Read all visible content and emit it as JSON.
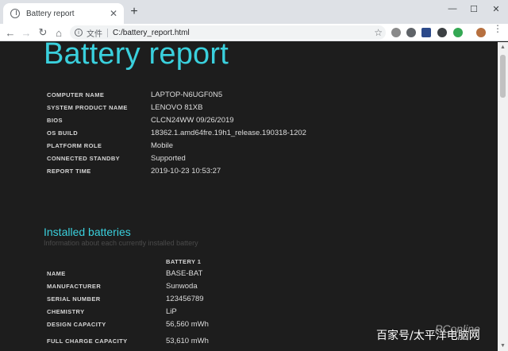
{
  "browser": {
    "tab_title": "Battery report",
    "tab_close": "✕",
    "new_tab": "+",
    "window_controls": {
      "minimize": "—",
      "maximize": "☐",
      "close": "✕"
    },
    "nav": {
      "back": "←",
      "forward": "→",
      "reload": "↻",
      "home": "⌂"
    },
    "omnibox": {
      "info": "i",
      "scheme": "文件",
      "url": "C:/battery_report.html",
      "star": "☆"
    },
    "extensions": [
      {
        "name": "ext-gray",
        "color": "#8a8a8a"
      },
      {
        "name": "ext-circle",
        "color": "#5f6368"
      },
      {
        "name": "ext-flag",
        "color": "#2c4a8a"
      },
      {
        "name": "ext-cloud",
        "color": "#3c4043"
      },
      {
        "name": "ext-green",
        "color": "#34a853"
      },
      {
        "name": "profile-avatar",
        "color": "#b7703f"
      }
    ],
    "menu": "⋮"
  },
  "report": {
    "title": "Battery report",
    "system": [
      {
        "key": "COMPUTER NAME",
        "value": "LAPTOP-N6UGF0N5"
      },
      {
        "key": "SYSTEM PRODUCT NAME",
        "value": "LENOVO 81XB"
      },
      {
        "key": "BIOS",
        "value": "CLCN24WW 09/26/2019"
      },
      {
        "key": "OS BUILD",
        "value": "18362.1.amd64fre.19h1_release.190318-1202"
      },
      {
        "key": "PLATFORM ROLE",
        "value": "Mobile"
      },
      {
        "key": "CONNECTED STANDBY",
        "value": "Supported"
      },
      {
        "key": "REPORT TIME",
        "value": "2019-10-23   10:53:27"
      }
    ],
    "installed": {
      "heading": "Installed batteries",
      "subheading": "Information about each currently installed battery",
      "column_header": "BATTERY 1",
      "rows": [
        {
          "key": "NAME",
          "value": "BASE-BAT"
        },
        {
          "key": "MANUFACTURER",
          "value": "Sunwoda"
        },
        {
          "key": "SERIAL NUMBER",
          "value": "123456789"
        },
        {
          "key": "CHEMISTRY",
          "value": "LiP"
        },
        {
          "key": "DESIGN CAPACITY",
          "value": "56,560 mWh"
        },
        {
          "key": "FULL CHARGE CAPACITY",
          "value": "53,610 mWh"
        }
      ]
    }
  },
  "watermark": {
    "text": "百家号/太平洋电脑网",
    "logo": "PConline"
  },
  "accent_color": "#3ad0dd"
}
